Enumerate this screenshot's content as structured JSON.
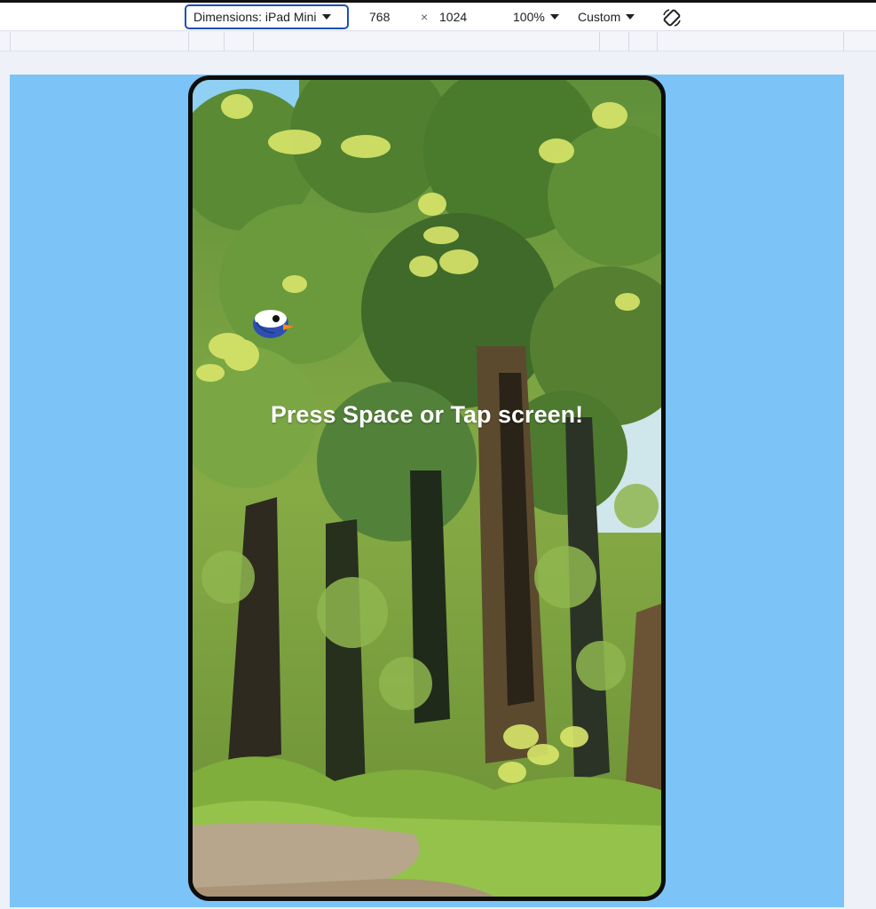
{
  "toolbar": {
    "dimensions_label": "Dimensions: iPad Mini",
    "width": "768",
    "times": "×",
    "height": "1024",
    "zoom": "100%",
    "throttle": "Custom",
    "rotate_icon": "rotate-icon"
  },
  "game": {
    "prompt": "Press Space or Tap screen!",
    "bird_icon": "bird-icon"
  },
  "colors": {
    "viewport_bg": "#7cc3f7",
    "accent": "#1d4fb8",
    "foliage_light": "#d9e66a",
    "foliage_mid": "#6f9a3c",
    "foliage_dark": "#3f6a2a",
    "trunk": "#2e2a1f"
  }
}
